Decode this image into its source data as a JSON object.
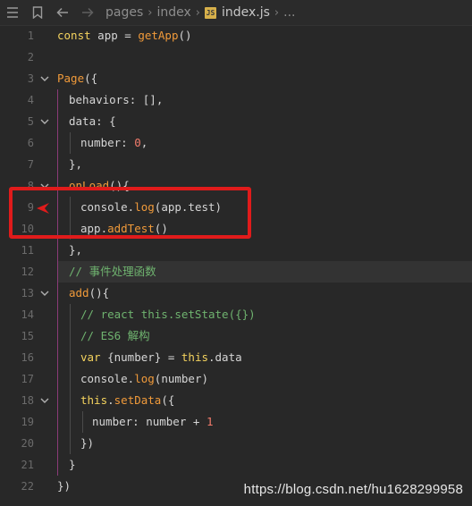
{
  "breadcrumb": {
    "items": [
      "pages",
      "index"
    ],
    "file_badge": "JS",
    "file": "index.js",
    "more": "..."
  },
  "lines": [
    {
      "num": "1",
      "text": "const app = getApp()"
    },
    {
      "num": "2",
      "text": ""
    },
    {
      "num": "3",
      "text": "Page({"
    },
    {
      "num": "4",
      "text": "behaviors: [],"
    },
    {
      "num": "5",
      "text": "data: {"
    },
    {
      "num": "6",
      "text": "number: 0,"
    },
    {
      "num": "7",
      "text": "},"
    },
    {
      "num": "8",
      "text": "onLoad(){"
    },
    {
      "num": "9",
      "text": "console.log(app.test)"
    },
    {
      "num": "10",
      "text": "app.addTest()"
    },
    {
      "num": "11",
      "text": "},"
    },
    {
      "num": "12",
      "text": "// 事件处理函数"
    },
    {
      "num": "13",
      "text": "add(){"
    },
    {
      "num": "14",
      "text": "// react this.setState({})"
    },
    {
      "num": "15",
      "text": "// ES6 解构"
    },
    {
      "num": "16",
      "text": "var {number} = this.data"
    },
    {
      "num": "17",
      "text": "console.log(number)"
    },
    {
      "num": "18",
      "text": "this.setData({"
    },
    {
      "num": "19",
      "text": "number: number + 1"
    },
    {
      "num": "20",
      "text": "})"
    },
    {
      "num": "21",
      "text": "}"
    },
    {
      "num": "22",
      "text": "})"
    }
  ],
  "watermark": "https://blog.csdn.net/hu1628299958",
  "colors": {
    "highlight_box": "#e01b1b",
    "background": "#282828",
    "keyword": "#f4d35e",
    "function": "#f09a3a",
    "number": "#f27b6b",
    "comment": "#6fb36f"
  }
}
